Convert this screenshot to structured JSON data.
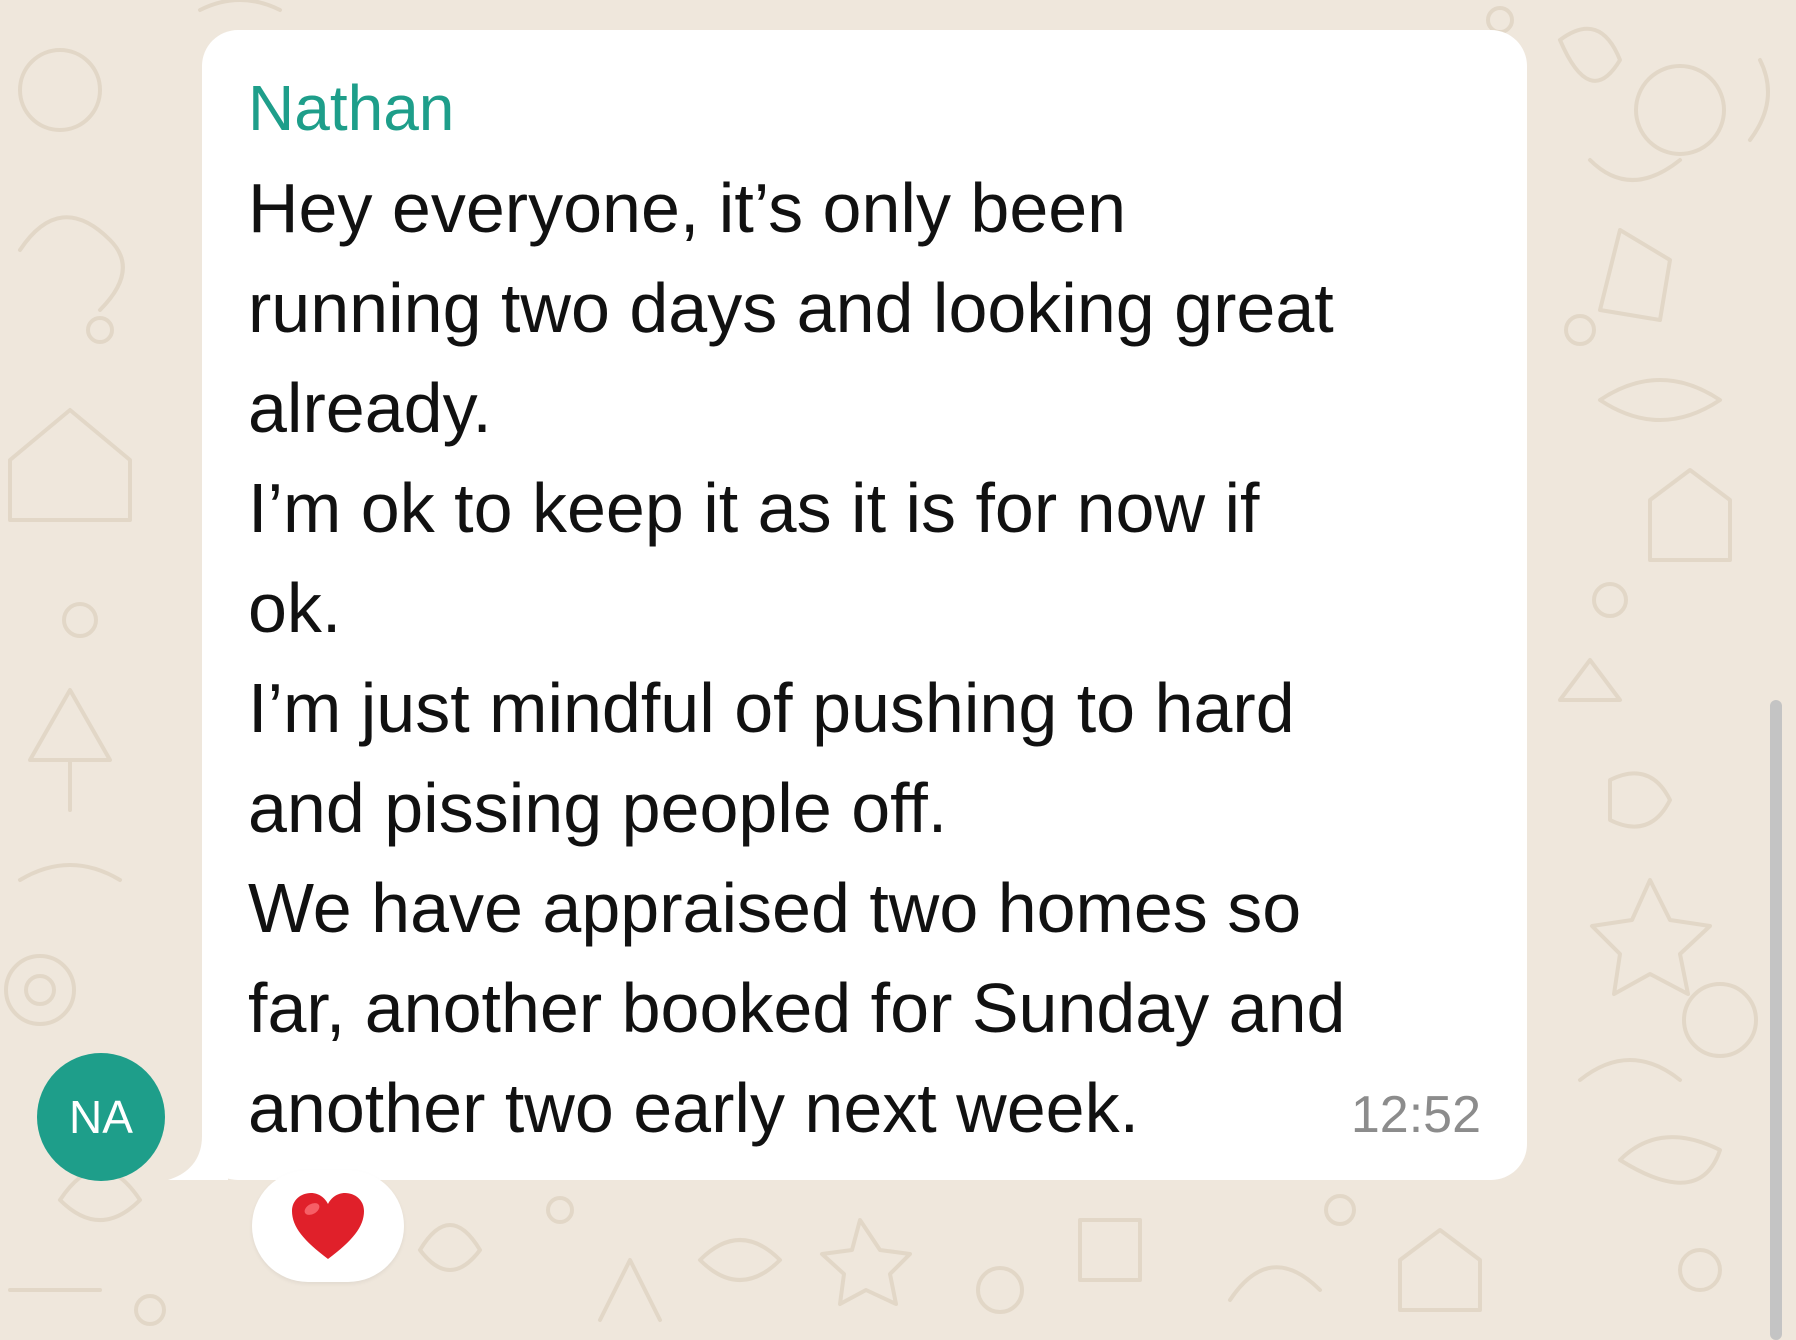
{
  "chat": {
    "avatar": {
      "initials": "NA",
      "color": "#1e9e8a"
    },
    "message": {
      "sender": "Nathan",
      "sender_color": "#1e9e8a",
      "lines": [
        "Hey everyone, it’s only been",
        "running two days and looking great",
        "already.",
        "I’m ok to keep it as it is for now if",
        "ok.",
        "I’m just mindful of pushing to hard",
        "and pissing people off.",
        "We have appraised two homes so",
        "far, another booked for Sunday and",
        "another two early next week."
      ],
      "time": "12:52",
      "reaction": {
        "icon": "red-heart-icon",
        "color": "#e0202a"
      }
    },
    "background_color": "#efe7dc",
    "bubble_color": "#ffffff"
  }
}
